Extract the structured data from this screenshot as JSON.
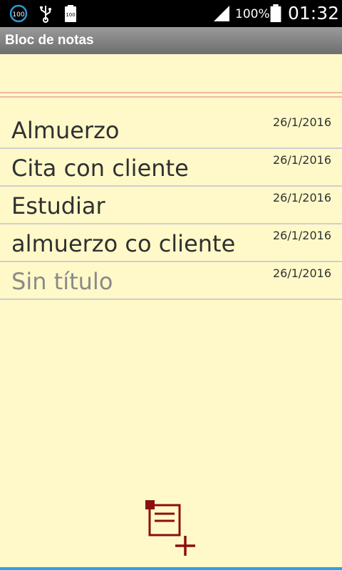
{
  "status_bar": {
    "battery_percent": "100%",
    "time": "01:32",
    "icons": [
      "battery-saver-100-icon",
      "usb-icon",
      "battery-100-icon",
      "signal-icon",
      "battery-full-icon"
    ],
    "left_badge": "100"
  },
  "app": {
    "title": "Bloc de notas"
  },
  "notes": [
    {
      "title": "Almuerzo",
      "date": "26/1/2016",
      "placeholder": false
    },
    {
      "title": "Cita con cliente",
      "date": "26/1/2016",
      "placeholder": false
    },
    {
      "title": "Estudiar",
      "date": "26/1/2016",
      "placeholder": false
    },
    {
      "title": "almuerzo co cliente",
      "date": "26/1/2016",
      "placeholder": false
    },
    {
      "title": "Sin título",
      "date": "26/1/2016",
      "placeholder": true
    }
  ],
  "actions": {
    "add_note_icon": "add-note-icon"
  },
  "colors": {
    "paper": "#fff9c9",
    "rule_line": "#f3b7a3",
    "icon": "#8b0f0f",
    "accent": "#2ba3e6"
  }
}
